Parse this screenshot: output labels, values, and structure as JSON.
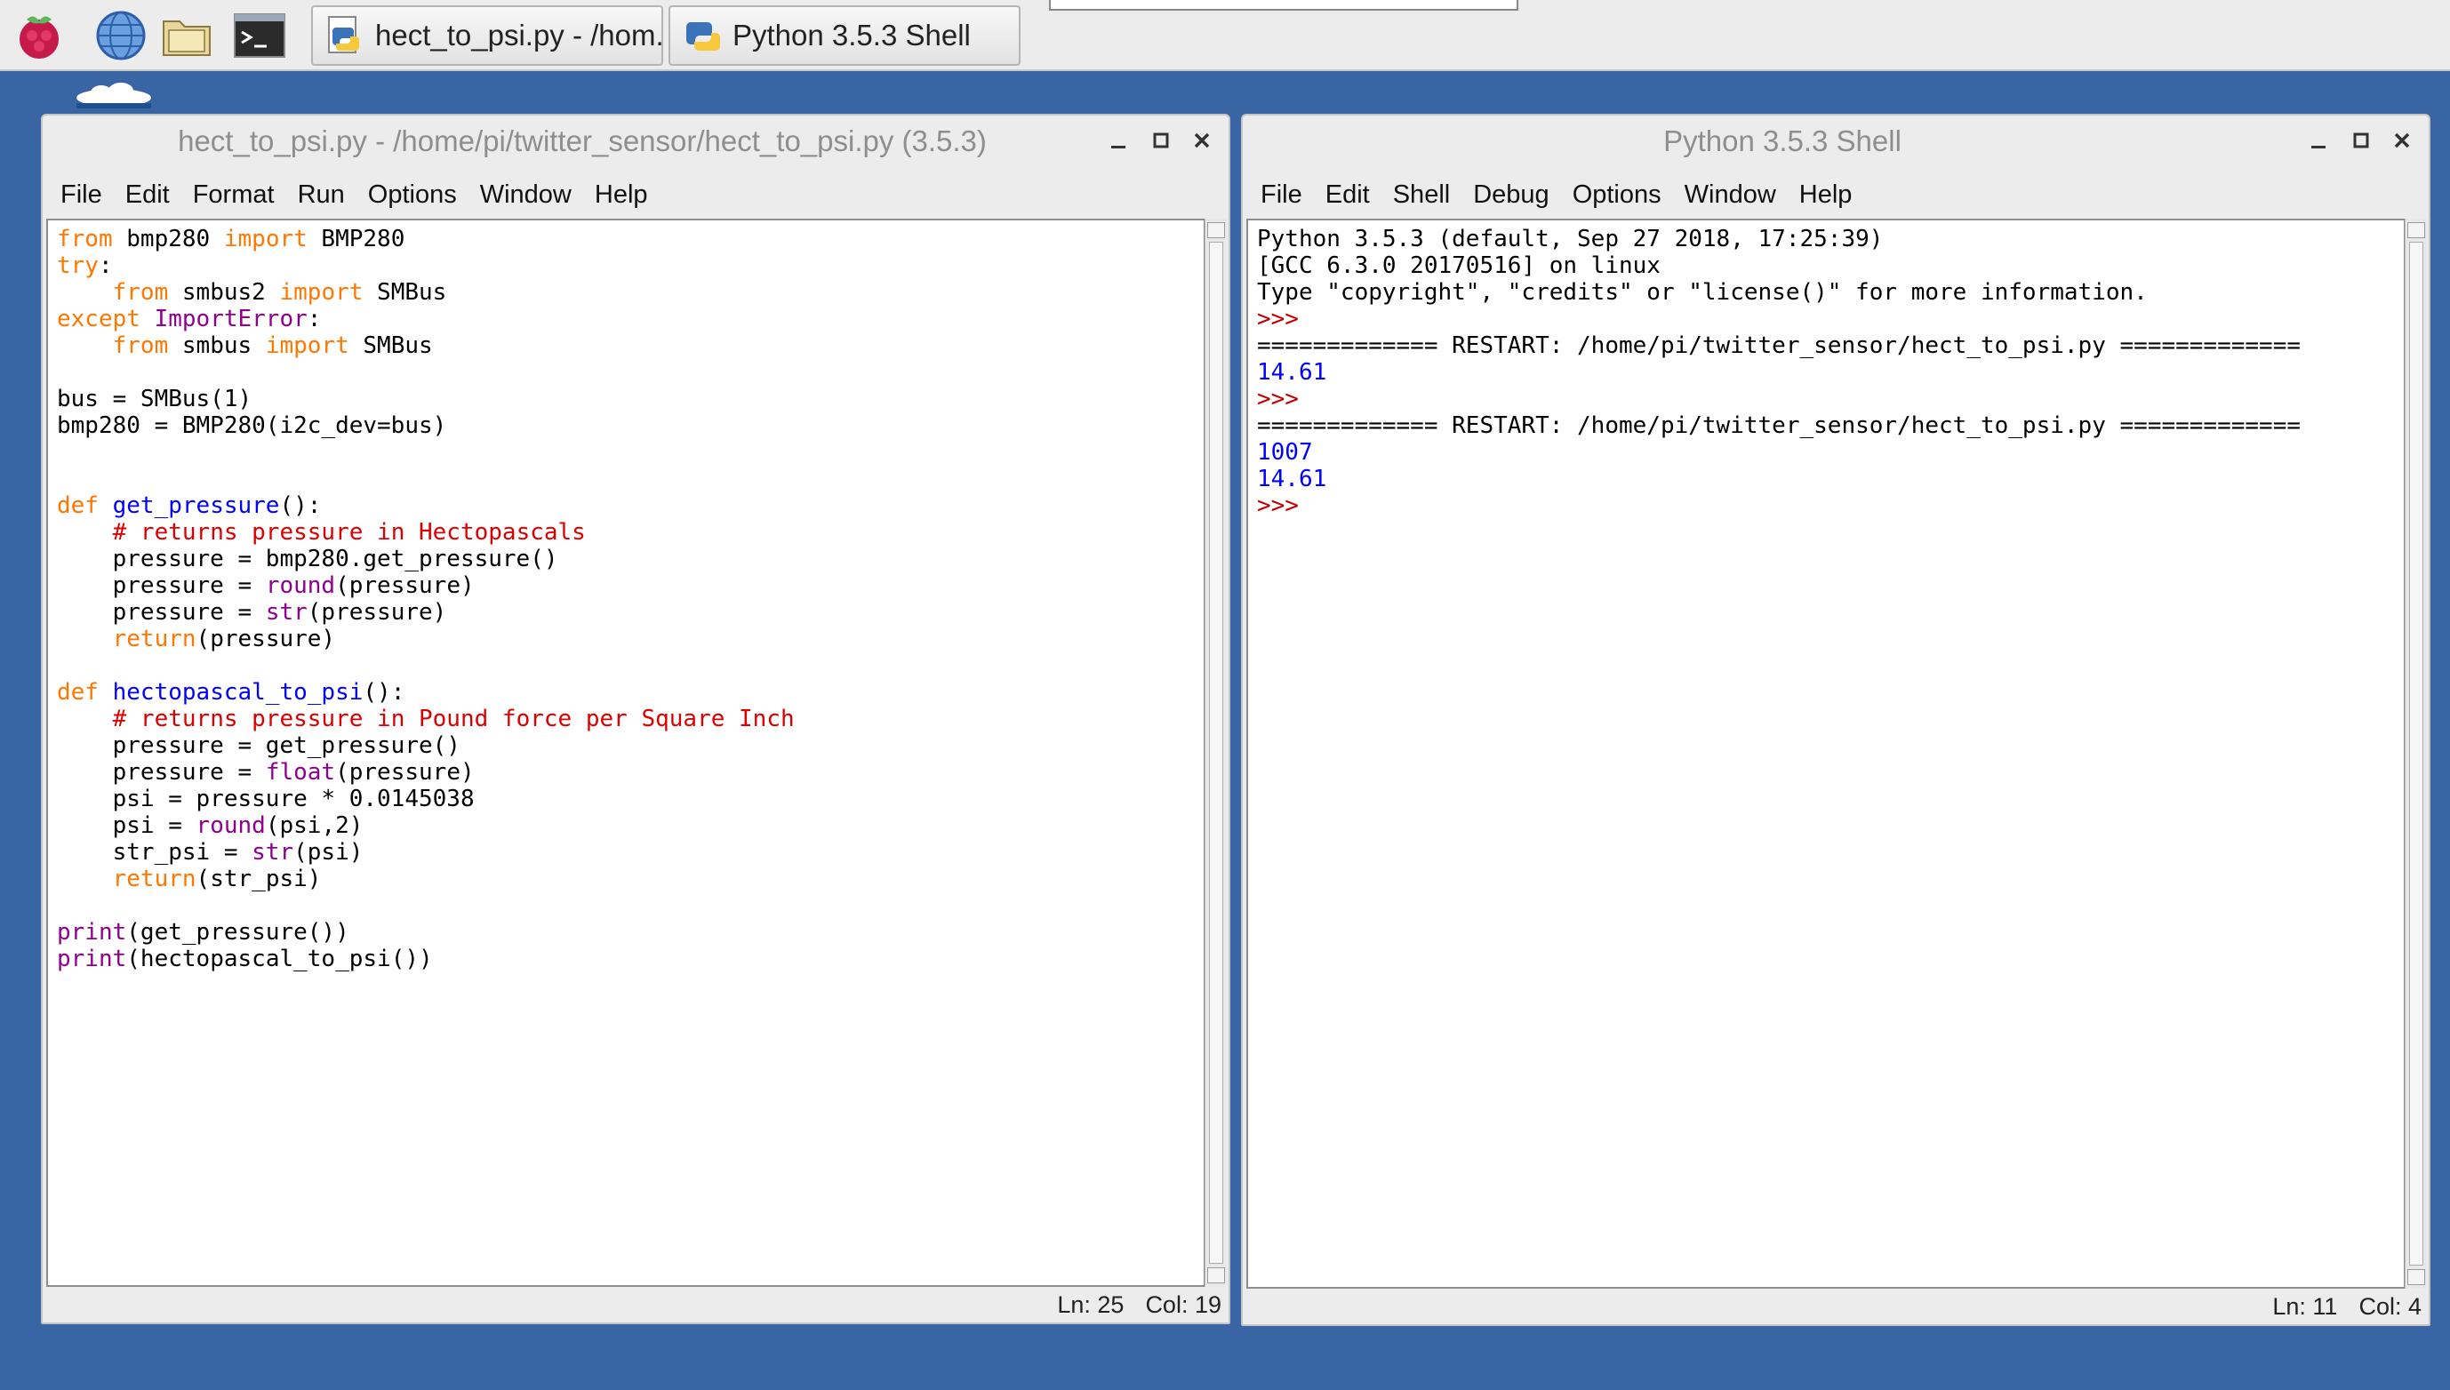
{
  "taskbar": {
    "tasks": [
      {
        "label": "hect_to_psi.py - /hom..."
      },
      {
        "label": "Python 3.5.3 Shell"
      }
    ]
  },
  "editor": {
    "title": "hect_to_psi.py - /home/pi/twitter_sensor/hect_to_psi.py (3.5.3)",
    "menu": [
      "File",
      "Edit",
      "Format",
      "Run",
      "Options",
      "Window",
      "Help"
    ],
    "status": {
      "ln": "Ln: 25",
      "col": "Col: 19"
    },
    "code": [
      [
        [
          "kw",
          "from"
        ],
        [
          "tx",
          " bmp280 "
        ],
        [
          "kw",
          "import"
        ],
        [
          "tx",
          " BMP280"
        ]
      ],
      [
        [
          "kw",
          "try"
        ],
        [
          "tx",
          ":"
        ]
      ],
      [
        [
          "tx",
          "    "
        ],
        [
          "kw",
          "from"
        ],
        [
          "tx",
          " smbus2 "
        ],
        [
          "kw",
          "import"
        ],
        [
          "tx",
          " SMBus"
        ]
      ],
      [
        [
          "kw",
          "except"
        ],
        [
          "tx",
          " "
        ],
        [
          "bi",
          "ImportError"
        ],
        [
          "tx",
          ":"
        ]
      ],
      [
        [
          "tx",
          "    "
        ],
        [
          "kw",
          "from"
        ],
        [
          "tx",
          " smbus "
        ],
        [
          "kw",
          "import"
        ],
        [
          "tx",
          " SMBus"
        ]
      ],
      [],
      [
        [
          "tx",
          "bus = SMBus(1)"
        ]
      ],
      [
        [
          "tx",
          "bmp280 = BMP280(i2c_dev=bus)"
        ]
      ],
      [],
      [],
      [
        [
          "kw",
          "def"
        ],
        [
          "tx",
          " "
        ],
        [
          "fn",
          "get_pressure"
        ],
        [
          "tx",
          "():"
        ]
      ],
      [
        [
          "tx",
          "    "
        ],
        [
          "cm",
          "# returns pressure in Hectopascals"
        ]
      ],
      [
        [
          "tx",
          "    pressure = bmp280.get_pressure()"
        ]
      ],
      [
        [
          "tx",
          "    pressure = "
        ],
        [
          "bi",
          "round"
        ],
        [
          "tx",
          "(pressure)"
        ]
      ],
      [
        [
          "tx",
          "    pressure = "
        ],
        [
          "bi",
          "str"
        ],
        [
          "tx",
          "(pressure)"
        ]
      ],
      [
        [
          "tx",
          "    "
        ],
        [
          "kw",
          "return"
        ],
        [
          "tx",
          "(pressure)"
        ]
      ],
      [],
      [
        [
          "kw",
          "def"
        ],
        [
          "tx",
          " "
        ],
        [
          "fn",
          "hectopascal_to_psi"
        ],
        [
          "tx",
          "():"
        ]
      ],
      [
        [
          "tx",
          "    "
        ],
        [
          "cm",
          "# returns pressure in Pound force per Square Inch"
        ]
      ],
      [
        [
          "tx",
          "    pressure = get_pressure()"
        ]
      ],
      [
        [
          "tx",
          "    pressure = "
        ],
        [
          "bi",
          "float"
        ],
        [
          "tx",
          "(pressure)"
        ]
      ],
      [
        [
          "tx",
          "    psi = pressure * 0.0145038"
        ]
      ],
      [
        [
          "tx",
          "    psi = "
        ],
        [
          "bi",
          "round"
        ],
        [
          "tx",
          "(psi,2)"
        ]
      ],
      [
        [
          "tx",
          "    str_psi = "
        ],
        [
          "bi",
          "str"
        ],
        [
          "tx",
          "(psi)"
        ]
      ],
      [
        [
          "tx",
          "    "
        ],
        [
          "kw",
          "return"
        ],
        [
          "tx",
          "(str_psi)"
        ]
      ],
      [],
      [
        [
          "bi",
          "print"
        ],
        [
          "tx",
          "(get_pressure())"
        ]
      ],
      [
        [
          "bi",
          "print"
        ],
        [
          "tx",
          "(hectopascal_to_psi())"
        ]
      ]
    ]
  },
  "shell": {
    "title": "Python 3.5.3 Shell",
    "menu": [
      "File",
      "Edit",
      "Shell",
      "Debug",
      "Options",
      "Window",
      "Help"
    ],
    "status": {
      "ln": "Ln: 11",
      "col": "Col: 4"
    },
    "lines": [
      [
        [
          "tx",
          "Python 3.5.3 (default, Sep 27 2018, 17:25:39)"
        ]
      ],
      [
        [
          "tx",
          "[GCC 6.3.0 20170516] on linux"
        ]
      ],
      [
        [
          "tx",
          "Type \"copyright\", \"credits\" or \"license()\" for more information."
        ]
      ],
      [
        [
          "prompt",
          ">>> "
        ]
      ],
      [
        [
          "tx",
          "============= RESTART: /home/pi/twitter_sensor/hect_to_psi.py ============="
        ]
      ],
      [
        [
          "out",
          "14.61"
        ]
      ],
      [
        [
          "prompt",
          ">>> "
        ]
      ],
      [
        [
          "tx",
          "============= RESTART: /home/pi/twitter_sensor/hect_to_psi.py ============="
        ]
      ],
      [
        [
          "out",
          "1007"
        ]
      ],
      [
        [
          "out",
          "14.61"
        ]
      ],
      [
        [
          "prompt",
          ">>> "
        ]
      ]
    ]
  }
}
